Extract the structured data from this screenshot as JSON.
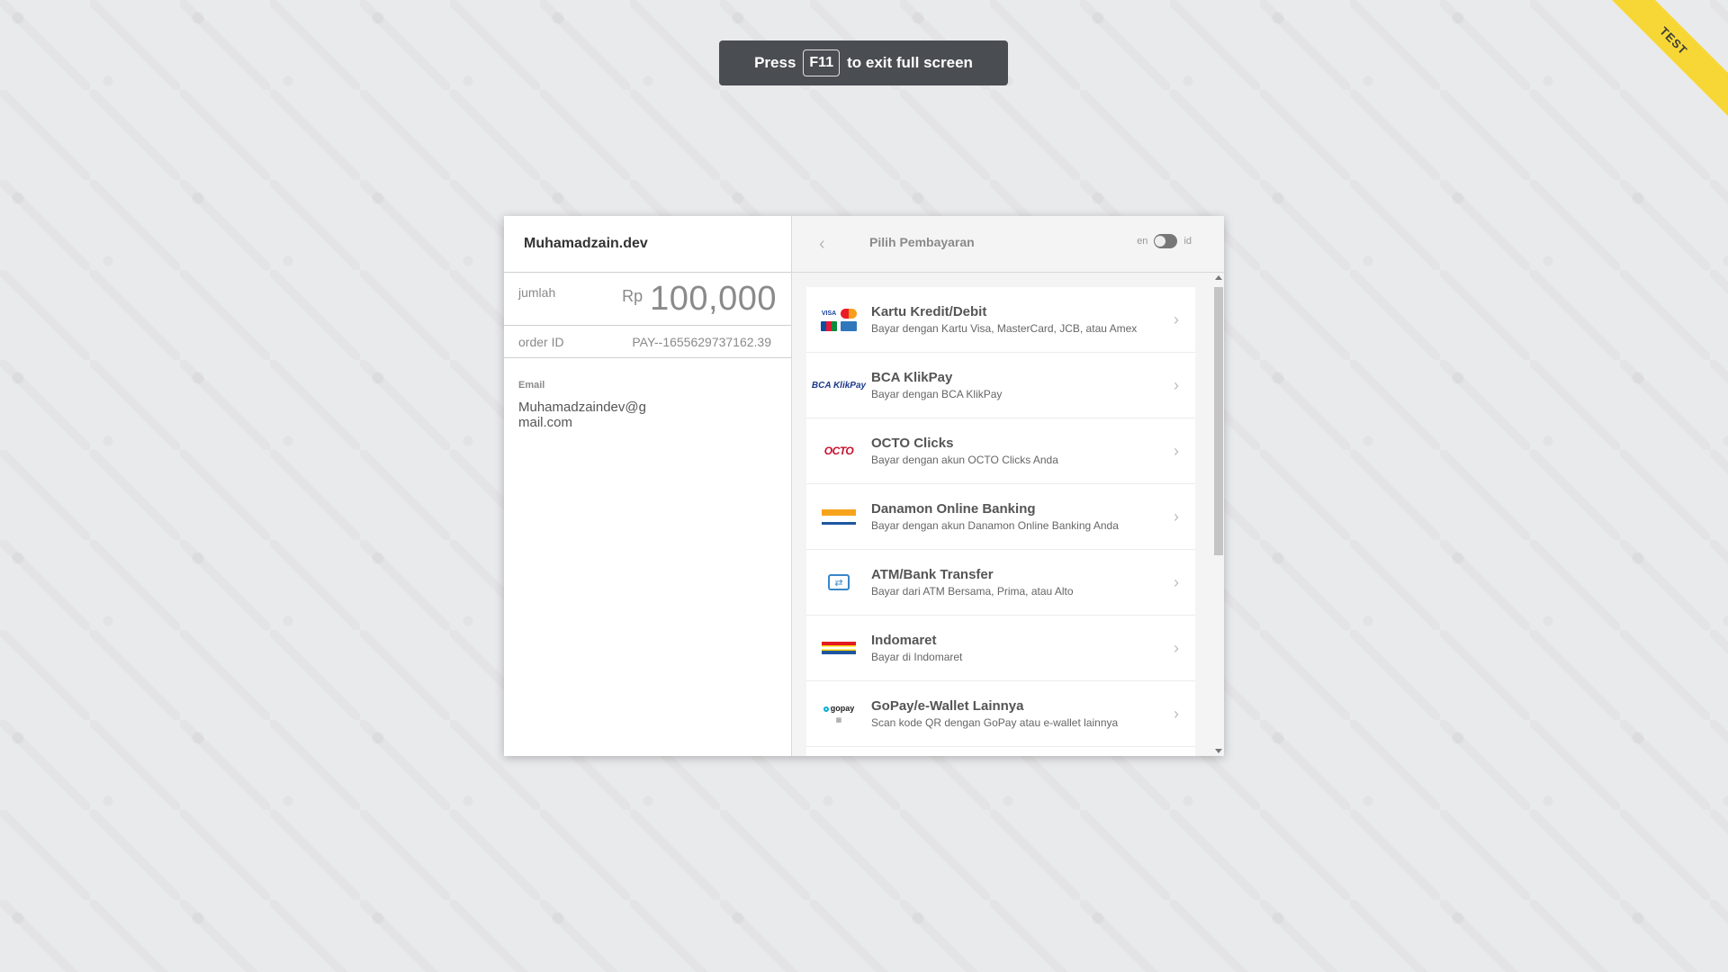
{
  "fullscreen_toast": {
    "press": "Press",
    "key": "F11",
    "suffix": "to exit full screen"
  },
  "ribbon": {
    "label": "TEST"
  },
  "merchant": {
    "name": "Muhamadzain.dev"
  },
  "amount": {
    "label": "jumlah",
    "currency": "Rp",
    "value": "100,000"
  },
  "order": {
    "label": "order ID",
    "value": "PAY--1655629737162.39"
  },
  "customer": {
    "email_label": "Email",
    "email_value": "Muhamadzaindev@gmail.com"
  },
  "header": {
    "back_icon": "chevron-left-icon",
    "title": "Pilih Pembayaran",
    "lang_en": "en",
    "lang_id": "id"
  },
  "payment_methods": [
    {
      "title": "Kartu Kredit/Debit",
      "subtitle": "Bayar dengan Kartu Visa, MasterCard, JCB, atau Amex",
      "logo_text": "VISA"
    },
    {
      "title": "BCA KlikPay",
      "subtitle": "Bayar dengan BCA KlikPay",
      "logo_text": "BCA KlikPay"
    },
    {
      "title": "OCTO Clicks",
      "subtitle": "Bayar dengan akun OCTO Clicks Anda",
      "logo_text": "OCTO"
    },
    {
      "title": "Danamon Online Banking",
      "subtitle": "Bayar dengan akun Danamon Online Banking Anda",
      "logo_text": ""
    },
    {
      "title": "ATM/Bank Transfer",
      "subtitle": "Bayar dari ATM Bersama, Prima, atau Alto",
      "logo_text": ""
    },
    {
      "title": "Indomaret",
      "subtitle": "Bayar di Indomaret",
      "logo_text": ""
    },
    {
      "title": "GoPay/e-Wallet Lainnya",
      "subtitle": "Scan kode QR dengan GoPay atau e-wallet lainnya",
      "logo_text": "gopay"
    }
  ]
}
